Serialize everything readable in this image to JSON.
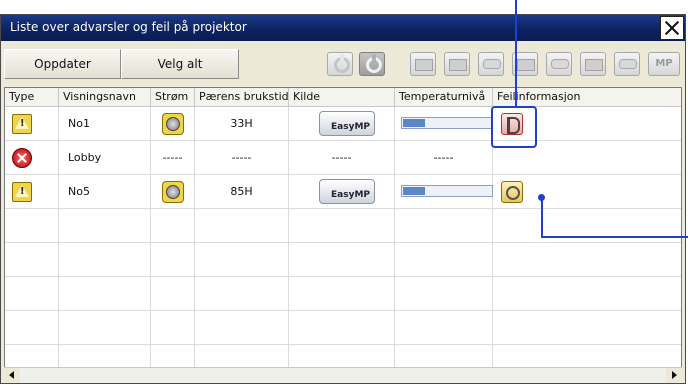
{
  "window": {
    "title": "Liste over advarsler og feil på projektor"
  },
  "toolbar": {
    "update_label": "Oppdater",
    "select_all_label": "Velg alt",
    "icons": [
      "power-on-icon",
      "power-off-icon",
      "computer-source-icon",
      "computer2-source-icon",
      "network-source-icon",
      "video-source-icon",
      "s-video-source-icon",
      "hdmi-source-icon",
      "audio-source-icon",
      "mp-source-icon"
    ],
    "mp_label": "MP"
  },
  "table": {
    "columns": [
      "Type",
      "Visningsnavn",
      "Strøm",
      "Pærens brukstid",
      "Kilde",
      "Temperaturnivå",
      "Feilinformasjon"
    ],
    "rows": [
      {
        "type": "warning",
        "name": "No1",
        "power": "lamp-warning",
        "lamp_time": "33H",
        "source": "EasyMP",
        "temperature_level": 0.25,
        "error_info": "cover-open-icon"
      },
      {
        "type": "error",
        "name": "Lobby",
        "power": "-----",
        "lamp_time": "-----",
        "source": "-----",
        "temperature_level": "-----",
        "error_info": ""
      },
      {
        "type": "warning",
        "name": "No5",
        "power": "lamp-warning",
        "lamp_time": "85H",
        "source": "EasyMP",
        "temperature_level": 0.25,
        "error_info": "fan-error-icon"
      }
    ]
  },
  "colors": {
    "titlebar": "#0d2360",
    "callout": "#1f3fcf",
    "warning": "#f0d44a",
    "error": "#d41f1f"
  }
}
